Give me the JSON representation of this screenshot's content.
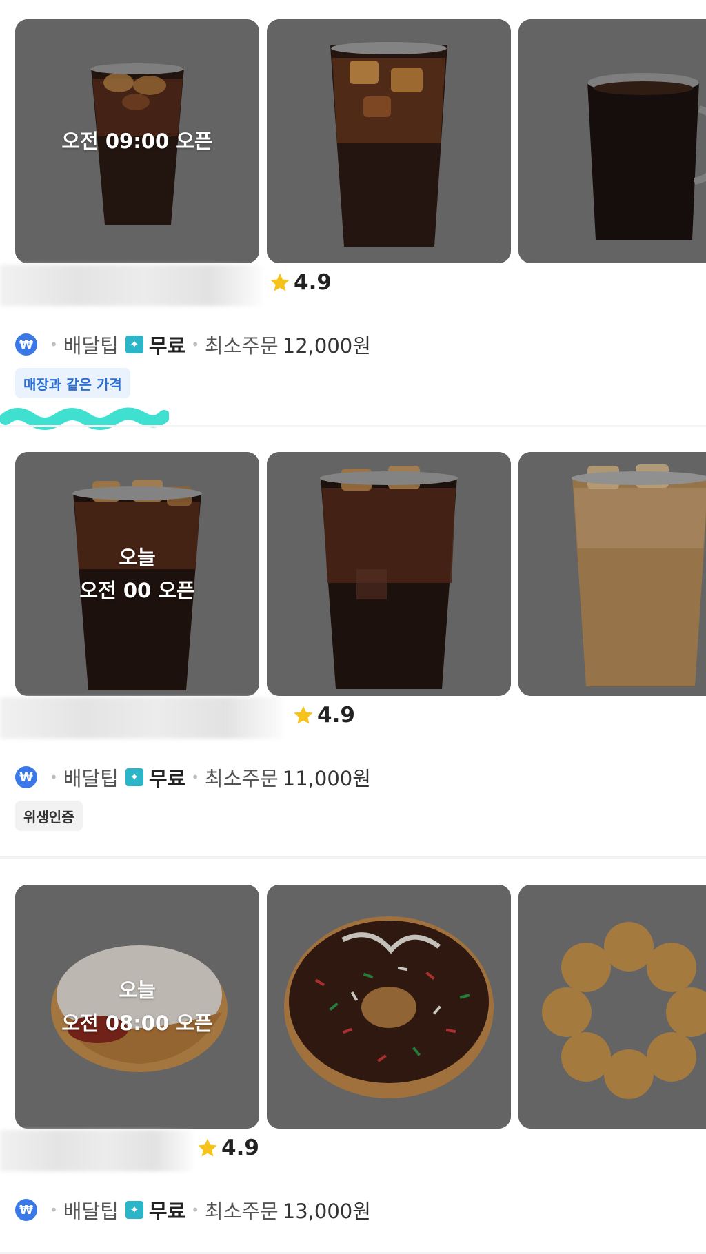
{
  "stores": [
    {
      "open_day": "",
      "open_time": "오전 09:00 오픈",
      "rating": "4.9",
      "delivery_tip_label": "배달팁",
      "delivery_tip_value": "무료",
      "min_order_label": "최소주문",
      "min_order_value": "12,000원",
      "tag": "매장과 같은 가격",
      "tag_style": "blue"
    },
    {
      "open_day": "오늘",
      "open_time": "오전 00 오픈",
      "rating": "4.9",
      "delivery_tip_label": "배달팁",
      "delivery_tip_value": "무료",
      "min_order_label": "최소주문",
      "min_order_value": "11,000원",
      "tag": "위생인증",
      "tag_style": "gray"
    },
    {
      "open_day": "오늘",
      "open_time": "오전 08:00 오픈",
      "rating": "4.9",
      "delivery_tip_label": "배달팁",
      "delivery_tip_value": "무료",
      "min_order_label": "최소주문",
      "min_order_value": "13,000원"
    }
  ],
  "icons": {
    "delivery_coupon": "won-coin-icon",
    "tip_badge": "bolt-icon",
    "rating": "star-icon"
  },
  "colors": {
    "star": "#f6c31c",
    "won_icon": "#3a78e8",
    "tip_badge": "#2bb5c8",
    "tag_blue_bg": "#e9f2fd",
    "tag_blue_text": "#2b6fd6",
    "highlight": "#3fe0cf"
  }
}
